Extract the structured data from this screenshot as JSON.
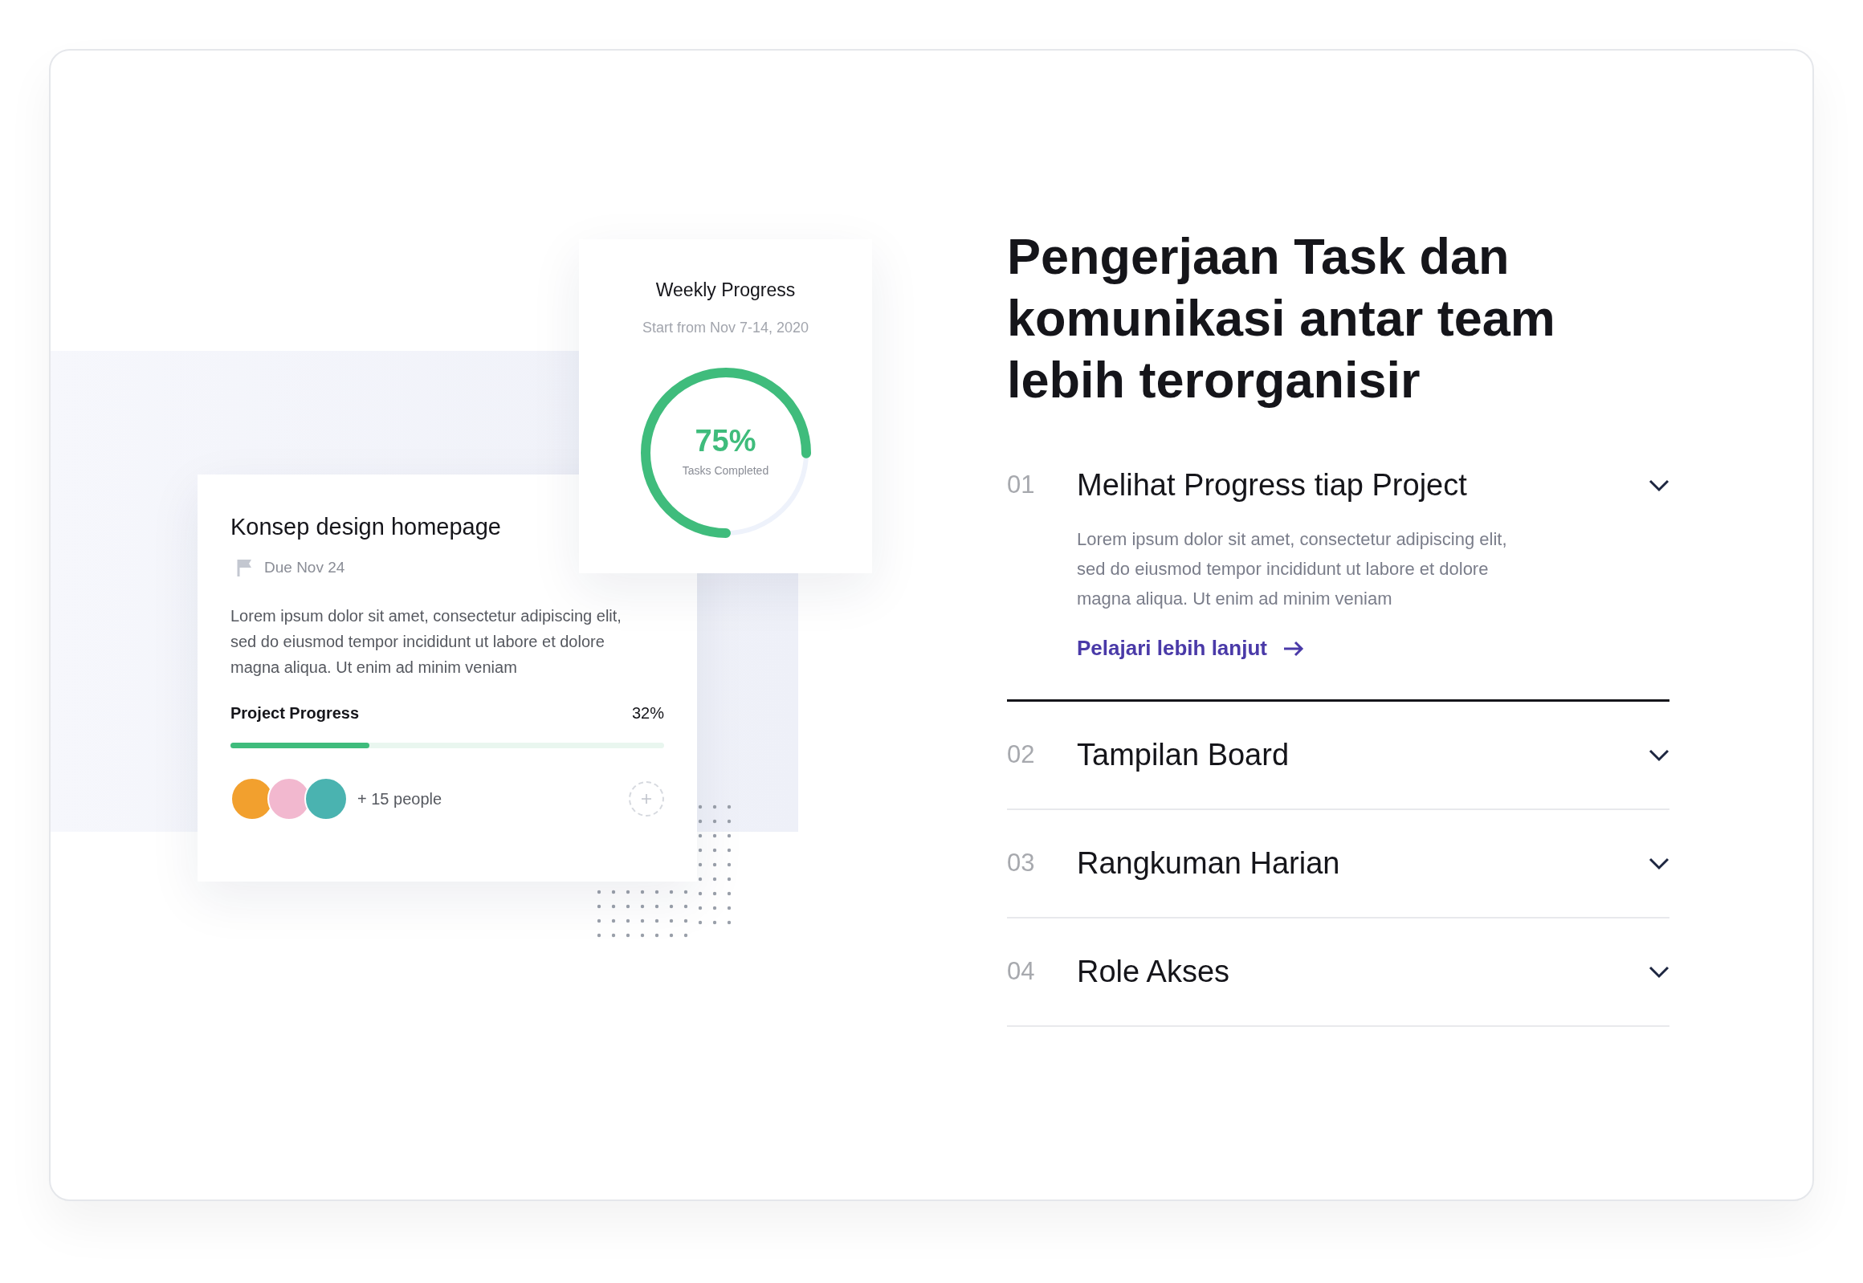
{
  "task_card": {
    "title": "Konsep design homepage",
    "due": "Due Nov 24",
    "description": "Lorem ipsum dolor sit amet, consectetur adipiscing elit, sed do eiusmod tempor incididunt ut labore et dolore magna aliqua. Ut enim ad minim veniam",
    "progress": {
      "label": "Project Progress",
      "reading": "32%",
      "level": 0.32
    },
    "people": "+ 15 people"
  },
  "weekly_card": {
    "title": "Weekly Progress",
    "subtitle": "Start from Nov 7-14, 2020",
    "reading": "75%",
    "caption": "Tasks Completed",
    "level": 0.75
  },
  "heading": "Pengerjaan Task dan komunikasi antar team lebih terorganisir",
  "features": [
    {
      "number": "01",
      "title": "Melihat Progress tiap Project",
      "expanded": true,
      "description": "Lorem ipsum dolor sit amet, consectetur adipiscing elit, sed do eiusmod tempor incididunt ut labore et dolore magna aliqua. Ut enim ad minim veniam",
      "link": "Pelajari lebih lanjut"
    },
    {
      "number": "02",
      "title": "Tampilan Board",
      "expanded": false
    },
    {
      "number": "03",
      "title": "Rangkuman Harian",
      "expanded": false
    },
    {
      "number": "04",
      "title": "Role Akses",
      "expanded": false
    }
  ]
}
